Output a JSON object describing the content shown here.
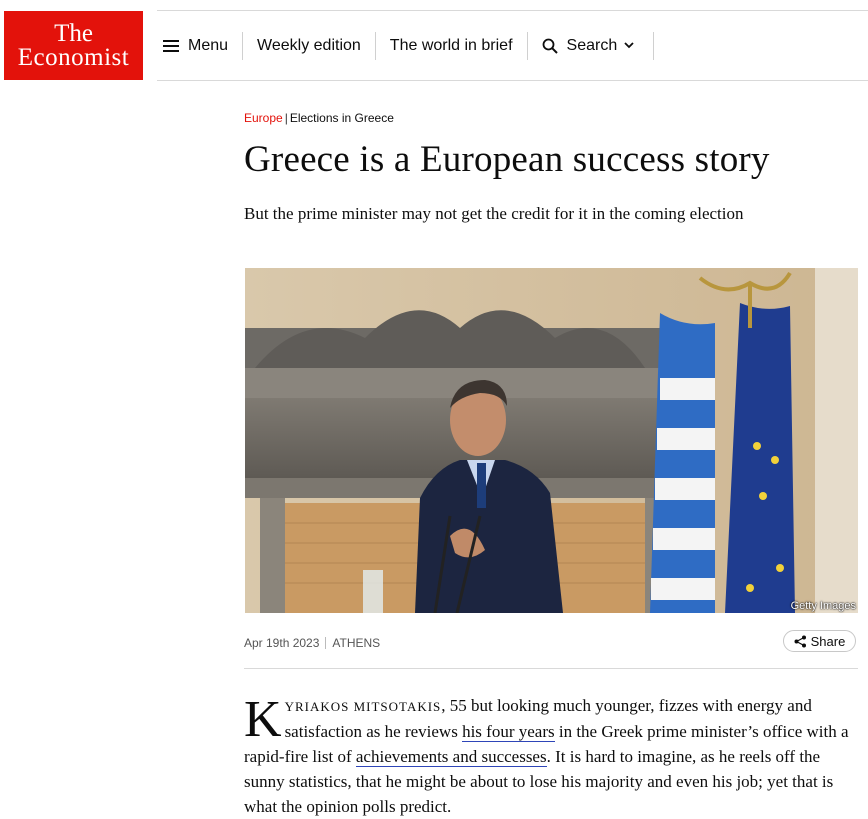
{
  "logo": {
    "line1": "The",
    "line2": "Economist",
    "color": "#e3120b"
  },
  "nav": {
    "menu_label": "Menu",
    "weekly_label": "Weekly edition",
    "world_label": "The world in brief",
    "search_label": "Search"
  },
  "article": {
    "section": "Europe",
    "separator": "|",
    "topic": "Elections in Greece",
    "headline": "Greece is a European success story",
    "standfirst": "But the prime minister may not get the credit for it in the coming election",
    "image_credit": "Getty Images",
    "date": "Apr 19th 2023",
    "location": "ATHENS",
    "share_label": "Share",
    "body": {
      "dropcap": "K",
      "smallcaps": "YRIAKOS MITSOTAKIS",
      "text1": ", 55 but looking much younger, fizzes with energy and satisfaction as he reviews ",
      "link1": "his four years",
      "text2": " in the Greek prime minister’s office with a rapid-fire list of ",
      "link2": "achievements and successes",
      "text3": ". It is hard to imagine, as he reels off the sunny statistics, that he might be about to lose his majority and even his job; yet that is what the opinion polls predict."
    }
  },
  "colors": {
    "accent": "#e3120b",
    "link_underline": "#2e45b8"
  },
  "icons": {
    "menu": "hamburger-icon",
    "search": "search-icon",
    "dropdown": "chevron-down-icon",
    "share": "share-icon"
  }
}
